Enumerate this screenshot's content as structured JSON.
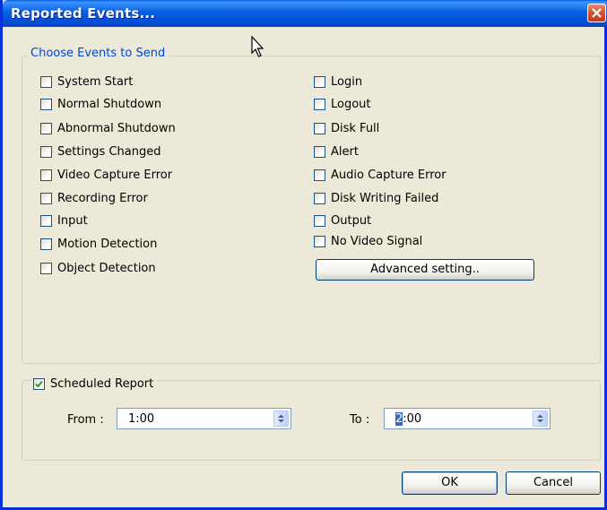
{
  "window": {
    "title": "Reported Events..."
  },
  "events_group": {
    "legend": "Choose Events to Send",
    "left": [
      {
        "label": "System Start",
        "checked": false
      },
      {
        "label": "Normal Shutdown",
        "checked": false
      },
      {
        "label": "Abnormal Shutdown",
        "checked": false
      },
      {
        "label": "Settings Changed",
        "checked": false
      },
      {
        "label": "Video Capture Error",
        "checked": false
      },
      {
        "label": "Recording Error",
        "checked": false
      },
      {
        "label": "Input",
        "checked": false
      },
      {
        "label": "Motion Detection",
        "checked": false
      },
      {
        "label": "Object Detection",
        "checked": false
      }
    ],
    "right": [
      {
        "label": "Login",
        "checked": false
      },
      {
        "label": "Logout",
        "checked": false
      },
      {
        "label": "Disk Full",
        "checked": false
      },
      {
        "label": "Alert",
        "checked": false
      },
      {
        "label": "Audio Capture Error",
        "checked": false
      },
      {
        "label": "Disk Writing Failed",
        "checked": false
      },
      {
        "label": "Output",
        "checked": false
      },
      {
        "label": "No Video Signal",
        "checked": false
      }
    ],
    "advanced_button": "Advanced setting.."
  },
  "schedule": {
    "label": "Scheduled Report",
    "checked": true,
    "from_label": "From :",
    "from_value": "1:00",
    "to_label": "To :",
    "to_value_caret": "2",
    "to_value_rest": ":00"
  },
  "buttons": {
    "ok": "OK",
    "cancel": "Cancel"
  },
  "colors": {
    "title_bar": "#0A5EE0",
    "dialog_bg": "#ECE9D8",
    "legend_text": "#0046D5",
    "close_button": "#D9502F"
  }
}
